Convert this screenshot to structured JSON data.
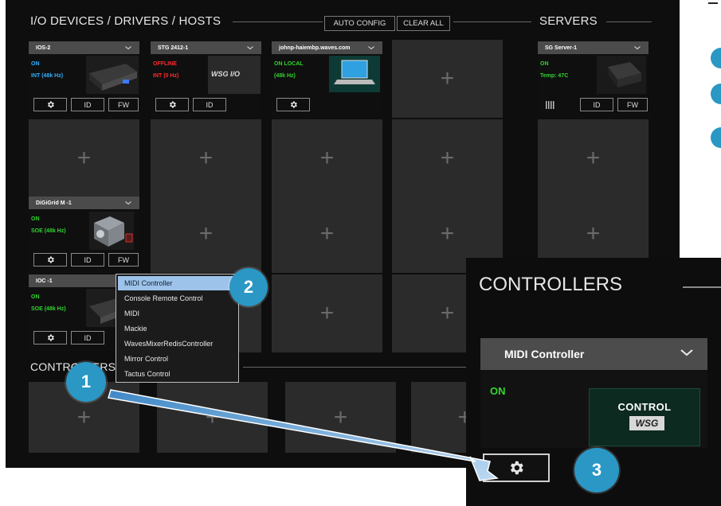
{
  "main": {
    "section_title": "I/O DEVICES / DRIVERS / HOSTS",
    "auto_config": "AUTO CONFIG",
    "clear_all": "CLEAR ALL",
    "servers_title": "SERVERS",
    "controllers_title": "CONTROLLERS"
  },
  "devices": [
    {
      "name": "IOS-2",
      "status": "ON",
      "clock": "INT (48k Hz)",
      "status_color": "#31d42e",
      "clock_color": "#2fb0ff",
      "buttons": [
        "ID",
        "FW"
      ]
    },
    {
      "name": "STG 2412-1",
      "status": "OFFLINE",
      "clock": "INT (0 Hz)",
      "status_color": "#ff2b2b",
      "clock_color": "#ff2b2b",
      "image_text": "WSG I/O",
      "buttons": [
        "ID"
      ]
    },
    {
      "name": "johnp-haiembp.waves.com",
      "status": "ON  LOCAL",
      "clock": "(48k Hz)",
      "status_color": "#31d42e",
      "clock_color": "#31d42e",
      "buttons": []
    },
    {
      "name": "DiGiGrid M -1",
      "status": "ON",
      "clock": "SOE (48k Hz)",
      "status_color": "#31d42e",
      "clock_color": "#31d42e",
      "buttons": [
        "ID",
        "FW"
      ]
    },
    {
      "name": "IOC -1",
      "status": "ON",
      "clock": "SOE (48k Hz)",
      "status_color": "#31d42e",
      "clock_color": "#31d42e",
      "buttons": [
        "ID"
      ]
    }
  ],
  "server": {
    "name": "SG Server-1",
    "status": "ON",
    "temp": "Temp: 47C",
    "status_color": "#31d42e",
    "buttons": [
      "ID",
      "FW"
    ]
  },
  "menu": {
    "items": [
      "MIDI Controller",
      "Console Remote Control",
      "MIDI",
      "Mackie",
      "WavesMixerRedisController",
      "Mirror Control",
      "Tactus Control"
    ],
    "selected_index": 0
  },
  "zoom": {
    "title": "CONTROLLERS",
    "device_name": "MIDI Controller",
    "status": "ON",
    "status_color": "#35d62e",
    "image_label": "CONTROL",
    "logo_text": "WSG"
  },
  "badges": [
    "1",
    "2",
    "3"
  ],
  "icons": {
    "gear": "gear-icon",
    "chevron": "chevron-down-icon",
    "plus": "plus-icon",
    "arrow": "arrow-icon"
  },
  "colors": {
    "accent": "#2a97c5",
    "on": "#31d42e",
    "offline": "#ff2b2b",
    "clock": "#2fb0ff",
    "menu_selected": "#9ec3ea"
  }
}
